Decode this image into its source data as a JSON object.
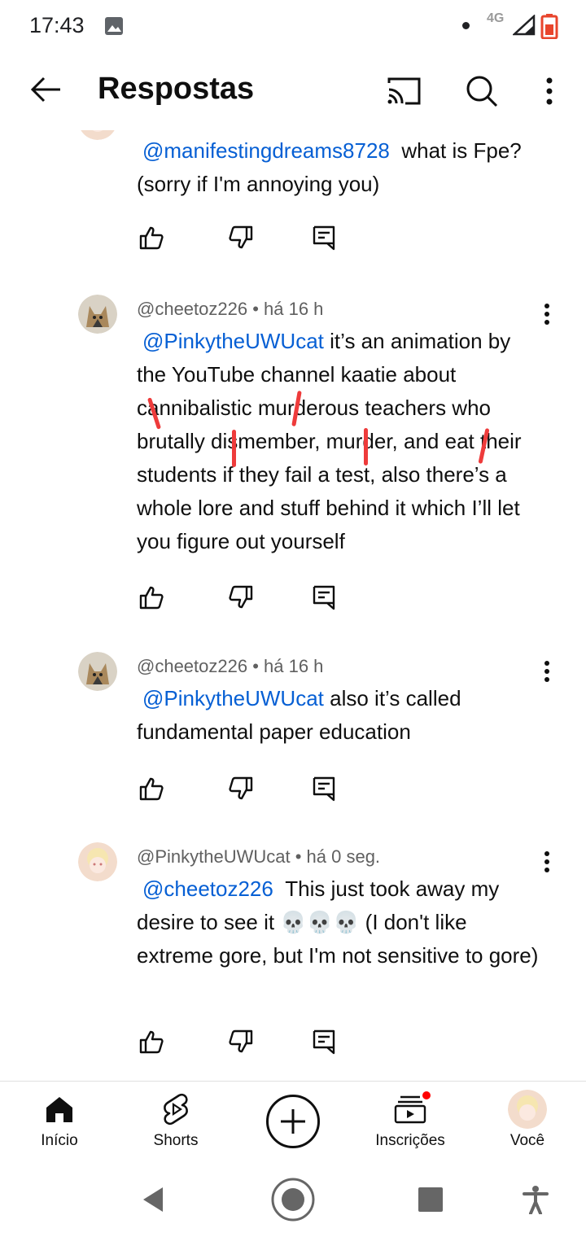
{
  "status_bar": {
    "time": "17:43",
    "network": "4G"
  },
  "header": {
    "title": "Respostas"
  },
  "comments": [
    {
      "author_meta": "",
      "mention": "@manifestingdreams8728",
      "text": "what is Fpe? (sorry if I'm annoying you)"
    },
    {
      "author_meta": "@cheetoz226 • há 16 h",
      "mention": "@PinkytheUWUcat",
      "text": "it’s an animation by the YouTube channel kaatie about cannibalistic murderous teachers who brutally dismember, murder, and eat their students if they fail a test, also there’s a whole lore and stuff behind it which I’ll let you figure out yourself"
    },
    {
      "author_meta": "@cheetoz226 • há 16 h",
      "mention": "@PinkytheUWUcat",
      "text": "also it’s called fundamental paper education"
    },
    {
      "author_meta": "@PinkytheUWUcat • há 0 seg.",
      "mention": "@cheetoz226",
      "text": "This just took away my desire to see it 💀💀💀 (I don't like extreme gore, but I'm not sensitive to gore)"
    }
  ],
  "bottom_nav": {
    "home": "Início",
    "shorts": "Shorts",
    "subscriptions": "Inscrições",
    "you": "Você"
  },
  "colors": {
    "mention": "#065fd4",
    "notification": "#ff0000",
    "annotation": "#ee3b3b"
  }
}
